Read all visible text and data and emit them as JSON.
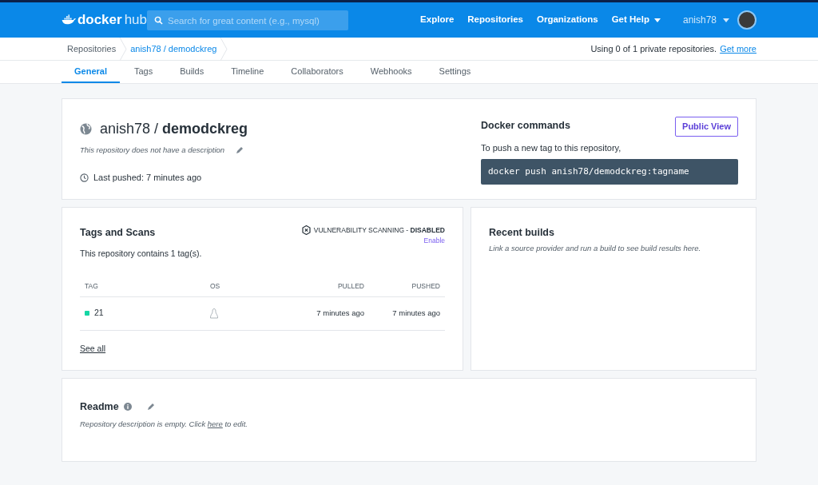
{
  "header": {
    "logo_text": "docker",
    "logo_suffix": "hub",
    "search": {
      "placeholder": "Search for great content (e.g., mysql)"
    },
    "nav": [
      {
        "label": "Explore",
        "dropdown": false
      },
      {
        "label": "Repositories",
        "dropdown": false
      },
      {
        "label": "Organizations",
        "dropdown": false
      },
      {
        "label": "Get Help",
        "dropdown": true
      }
    ],
    "user": "anish78"
  },
  "breadcrumbs": [
    "Repositories",
    "anish78 / demodckreg"
  ],
  "usage": {
    "text": "Using 0 of 1 private repositories.",
    "link": "Get more"
  },
  "tabs": [
    {
      "label": "General",
      "selected": true
    },
    {
      "label": "Tags",
      "selected": false
    },
    {
      "label": "Builds",
      "selected": false
    },
    {
      "label": "Timeline",
      "selected": false
    },
    {
      "label": "Collaborators",
      "selected": false
    },
    {
      "label": "Webhooks",
      "selected": false
    },
    {
      "label": "Settings",
      "selected": false
    }
  ],
  "repository": {
    "owner": "anish78",
    "separator": "/",
    "name": "demodckreg",
    "description": "This repository does not have a description",
    "last_pushed": "Last pushed: 7 minutes ago"
  },
  "docker_commands": {
    "title": "Docker commands",
    "button": "Public View",
    "hint": "To push a new tag to this repository,",
    "command": "docker push anish78/demodckreg:tagname"
  },
  "tags_and_scans": {
    "title": "Tags and Scans",
    "scanning": "VULNERABILITY SCANNING - **DISABLED**",
    "enable": "Enable",
    "summary": "This repository contains 1 tag(s).",
    "columns": [
      "TAG",
      "OS",
      "PULLED",
      "PUSHED"
    ],
    "rows": [
      {
        "tag": "21",
        "color": "#16d6a4",
        "pulled": "7 minutes ago",
        "pushed": "7 minutes ago"
      }
    ],
    "see_all": "See all"
  },
  "recent_builds": {
    "title": "Recent builds",
    "text": "Link a source provider and run a build to see build results here."
  },
  "readme": {
    "title": "Readme",
    "before": "Repository description is empty. Click",
    "link": "here",
    "after": "to edit."
  }
}
